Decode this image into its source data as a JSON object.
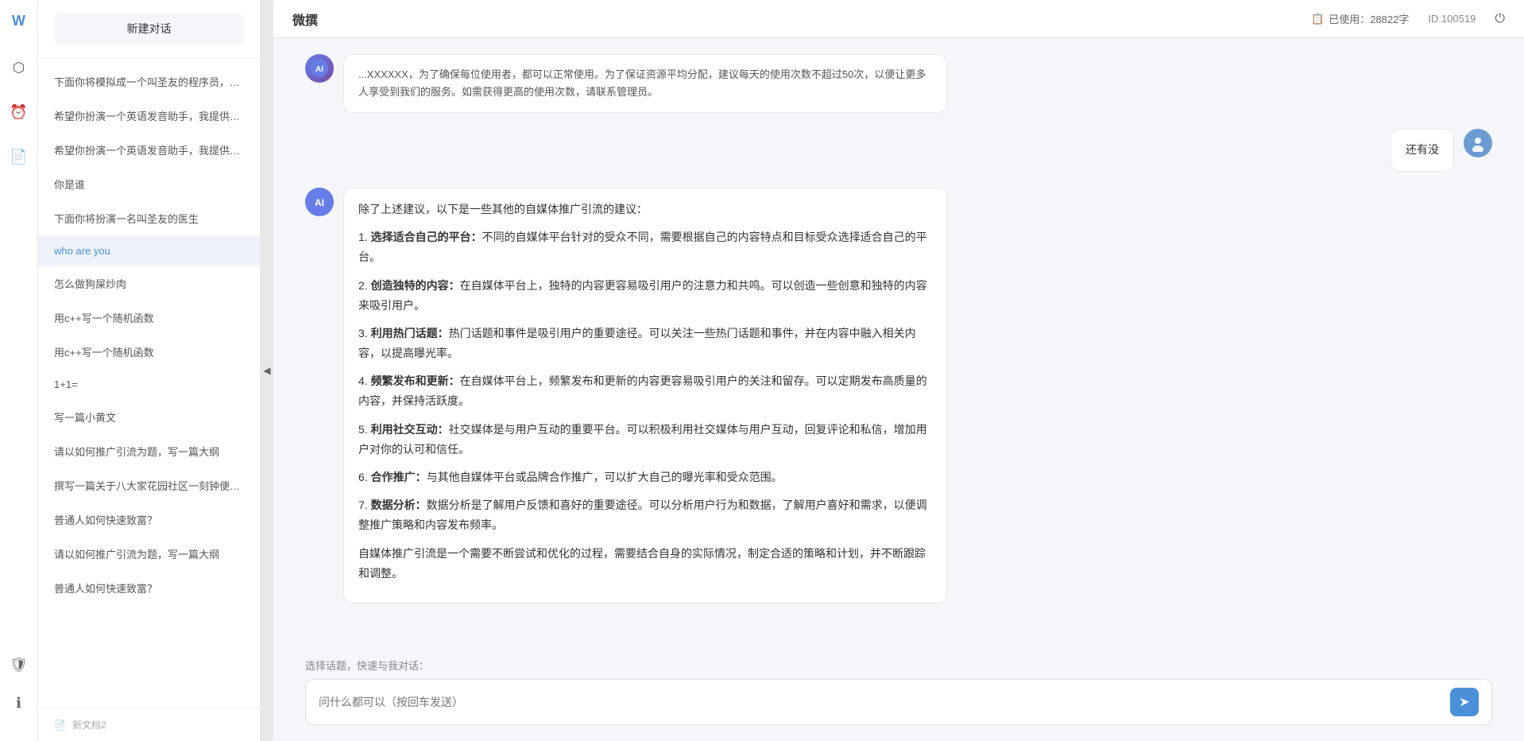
{
  "app": {
    "title": "微撰",
    "usage_label": "已使用：28822字",
    "id_label": "ID:100519"
  },
  "topbar": {
    "title": "微撰",
    "usage_icon": "📋",
    "usage_text": "已使用：28822字",
    "id_text": "ID:100519"
  },
  "sidebar": {
    "new_chat_label": "新建对话",
    "items": [
      {
        "id": 1,
        "label": "下面你将模拟成一个叫圣友的程序员，我说..."
      },
      {
        "id": 2,
        "label": "希望你扮演一个英语发音助手，我提供给你..."
      },
      {
        "id": 3,
        "label": "希望你扮演一个英语发音助手，我提供给你..."
      },
      {
        "id": 4,
        "label": "你是谁"
      },
      {
        "id": 5,
        "label": "下面你将扮演一名叫圣友的医生"
      },
      {
        "id": 6,
        "label": "who are you",
        "active": true
      },
      {
        "id": 7,
        "label": "怎么做狗屎炒肉"
      },
      {
        "id": 8,
        "label": "用c++写一个随机函数"
      },
      {
        "id": 9,
        "label": "用c++写一个随机函数"
      },
      {
        "id": 10,
        "label": "1+1="
      },
      {
        "id": 11,
        "label": "写一篇小黄文"
      },
      {
        "id": 12,
        "label": "请以如何推广引流为题，写一篇大纲"
      },
      {
        "id": 13,
        "label": "撰写一篇关于八大家花园社区一刻钟便民生..."
      },
      {
        "id": 14,
        "label": "普通人如何快速致富？"
      },
      {
        "id": 15,
        "label": "请以如何推广引流为题，写一篇大纲"
      },
      {
        "id": 16,
        "label": "普通人如何快速致富？"
      }
    ],
    "bottom_label": "新文档2"
  },
  "chat": {
    "top_message": {
      "text": "...XXXXXX，为了确保每位使用者，都可以正常使用。为了保证资源平均分配，建议每天的使用次数不超过50次，以便让更多人享受到我们的服务。如需获得更高的使用次数，请联系管理员。"
    },
    "user_message": {
      "avatar_label": "用户头像",
      "text": "还有没"
    },
    "ai_message": {
      "avatar_label": "AI",
      "intro": "除了上述建议，以下是一些其他的自媒体推广引流的建议：",
      "points": [
        {
          "num": "1",
          "title": "选择适合自己的平台：",
          "content": "不同的自媒体平台针对的受众不同，需要根据自己的内容特点和目标受众选择适合自己的平台。"
        },
        {
          "num": "2",
          "title": "创造独特的内容：",
          "content": "在自媒体平台上，独特的内容更容易吸引用户的注意力和共鸣。可以创造一些创意和独特的内容来吸引用户。"
        },
        {
          "num": "3",
          "title": "利用热门话题：",
          "content": "热门话题和事件是吸引用户的重要途径。可以关注一些热门话题和事件，并在内容中融入相关内容，以提高曝光率。"
        },
        {
          "num": "4",
          "title": "频繁发布和更新：",
          "content": "在自媒体平台上，频繁发布和更新的内容更容易吸引用户的关注和留存。可以定期发布高质量的内容，并保持活跃度。"
        },
        {
          "num": "5",
          "title": "利用社交互动：",
          "content": "社交媒体是与用户互动的重要平台。可以积极利用社交媒体与用户互动，回复评论和私信，增加用户对你的认可和信任。"
        },
        {
          "num": "6",
          "title": "合作推广：",
          "content": "与其他自媒体平台或品牌合作推广，可以扩大自己的曝光率和受众范围。"
        },
        {
          "num": "7",
          "title": "数据分析：",
          "content": "数据分析是了解用户反馈和喜好的重要途径。可以分析用户行为和数据，了解用户喜好和需求，以便调整推广策略和内容发布频率。"
        }
      ],
      "conclusion": "自媒体推广引流是一个需要不断尝试和优化的过程，需要结合自身的实际情况，制定合适的策略和计划，并不断跟踪和调整。"
    }
  },
  "input": {
    "quick_topics_label": "选择话题，快速与我对话：",
    "placeholder": "问什么都可以（按回车发送）",
    "send_icon": "➤"
  },
  "icons": {
    "logo": "W",
    "hexagon": "⬡",
    "clock": "🕐",
    "document": "📄",
    "shield": "🛡",
    "info": "ℹ",
    "power": "⏻",
    "usage_icon": "📋",
    "toggle_arrow": "◀",
    "send": "➤"
  }
}
